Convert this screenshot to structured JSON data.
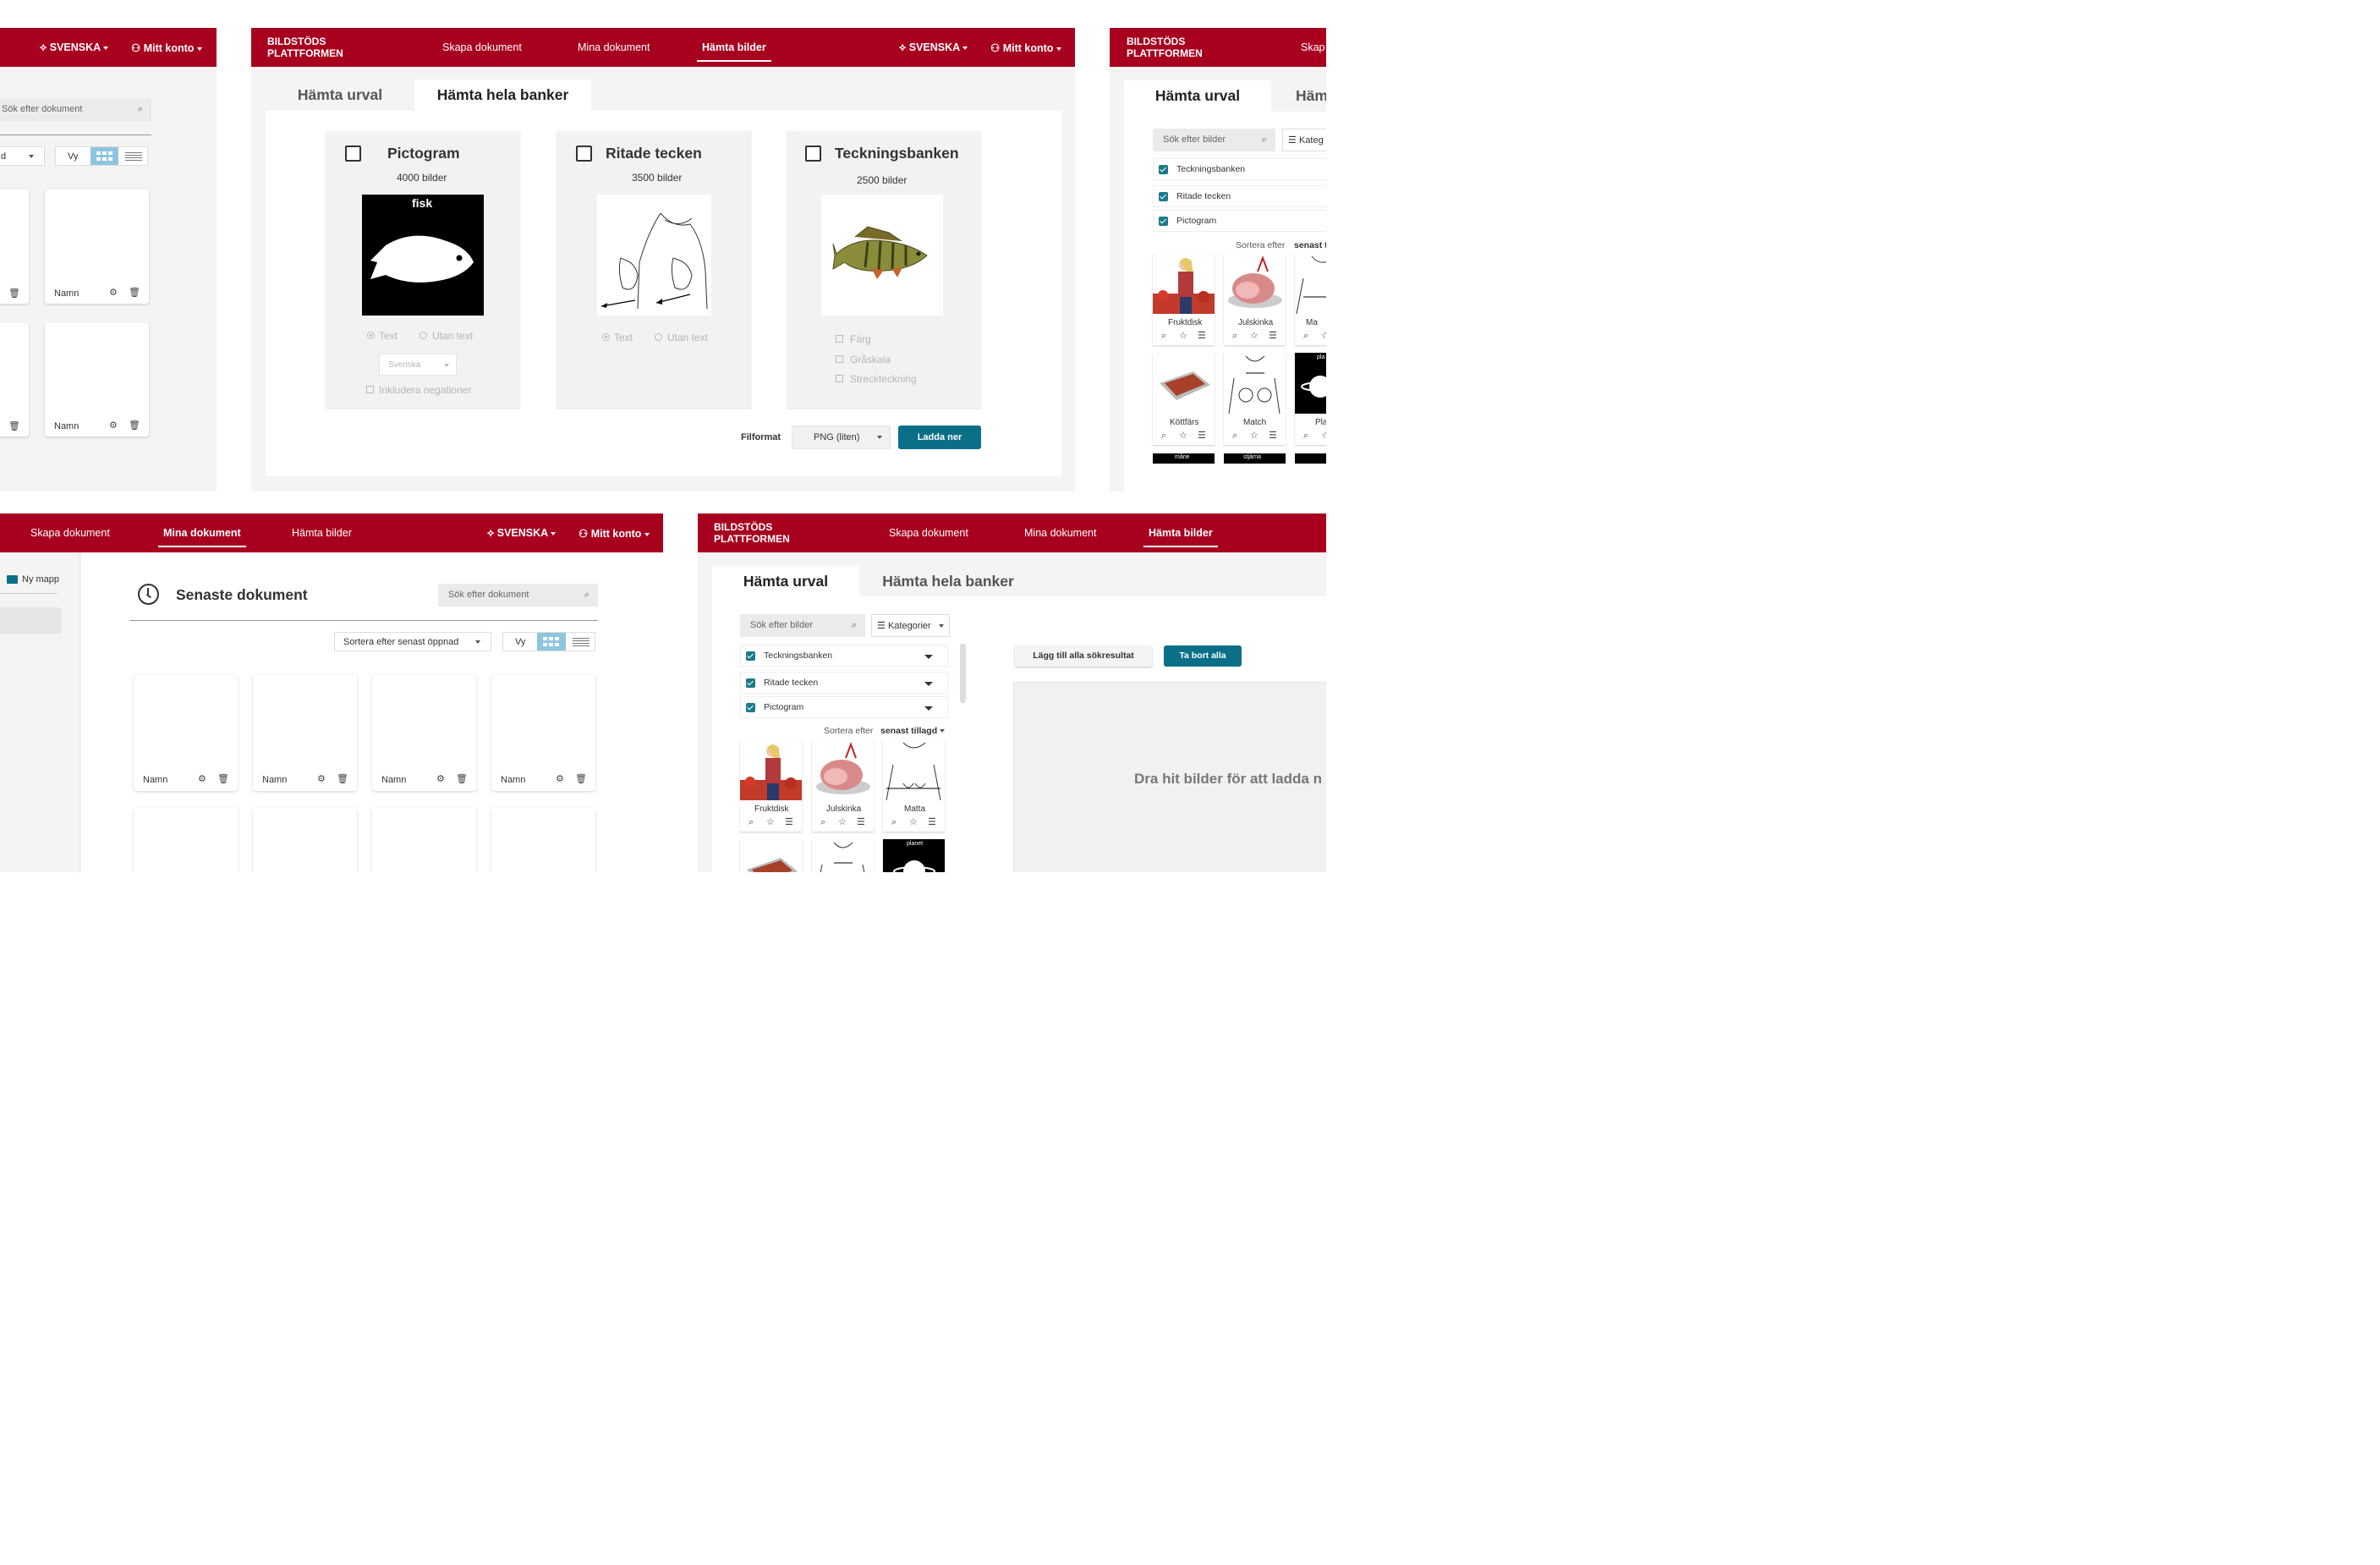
{
  "brand": {
    "line1": "BILDSTÖDS",
    "line2": "PLATTFORMEN",
    "color": "#a8001f"
  },
  "nav": {
    "create": "Skapa dokument",
    "mine": "Mina dokument",
    "fetch": "Hämta bilder",
    "language": "SVENSKA",
    "account": "Mitt konto"
  },
  "tabs": {
    "selection": "Hämta urval",
    "banks": "Hämta hela banker"
  },
  "banks": [
    {
      "name": "Pictogram",
      "count": "4000 bilder",
      "image_label": "fisk",
      "opt_text": "Text",
      "opt_notext": "Utan text",
      "language": "Svenska",
      "negations": "Inkludera negationer"
    },
    {
      "name": "Ritade tecken",
      "count": "3500 bilder",
      "opt_text": "Text",
      "opt_notext": "Utan text"
    },
    {
      "name": "Teckningsbanken",
      "count": "2500 bilder",
      "opt_color": "Färg",
      "opt_gray": "Gråskala",
      "opt_line": "Streckteckning"
    }
  ],
  "download": {
    "format_label": "Filformat",
    "format_value": "PNG (liten)",
    "button": "Ladda ner",
    "accent": "#0b6f87"
  },
  "documents": {
    "search_placeholder": "Sök efter dokument",
    "title": "Senaste dokument",
    "sort": "Sortera efter senast öppnad",
    "view": "Vy",
    "new_folder": "Ny mapp",
    "card_name": "Namn",
    "sort_partial": "d"
  },
  "images": {
    "search_placeholder": "Sök efter bilder",
    "categories": "Kategorier",
    "categories_partial": "Kateg",
    "filters": [
      "Teckningsbanken",
      "Ritade tecken",
      "Pictogram"
    ],
    "sort_label": "Sortera efter",
    "sort_value": "senast tillagd",
    "sort_value_partial": "senast t",
    "items": [
      "Fruktdisk",
      "Julskinka",
      "Matta",
      "Köttfärs",
      "Match"
    ],
    "item_partial_ma": "Ma",
    "item_partial_pla": "Pla",
    "image_labels": {
      "mane": "måne",
      "stjarna": "stjärna",
      "planet": "planet",
      "planet_partial": "pla"
    },
    "add_all": "Lägg till alla sökresultat",
    "remove_all": "Ta bort alla",
    "drop_hint": "Dra hit bilder för att ladda n"
  }
}
